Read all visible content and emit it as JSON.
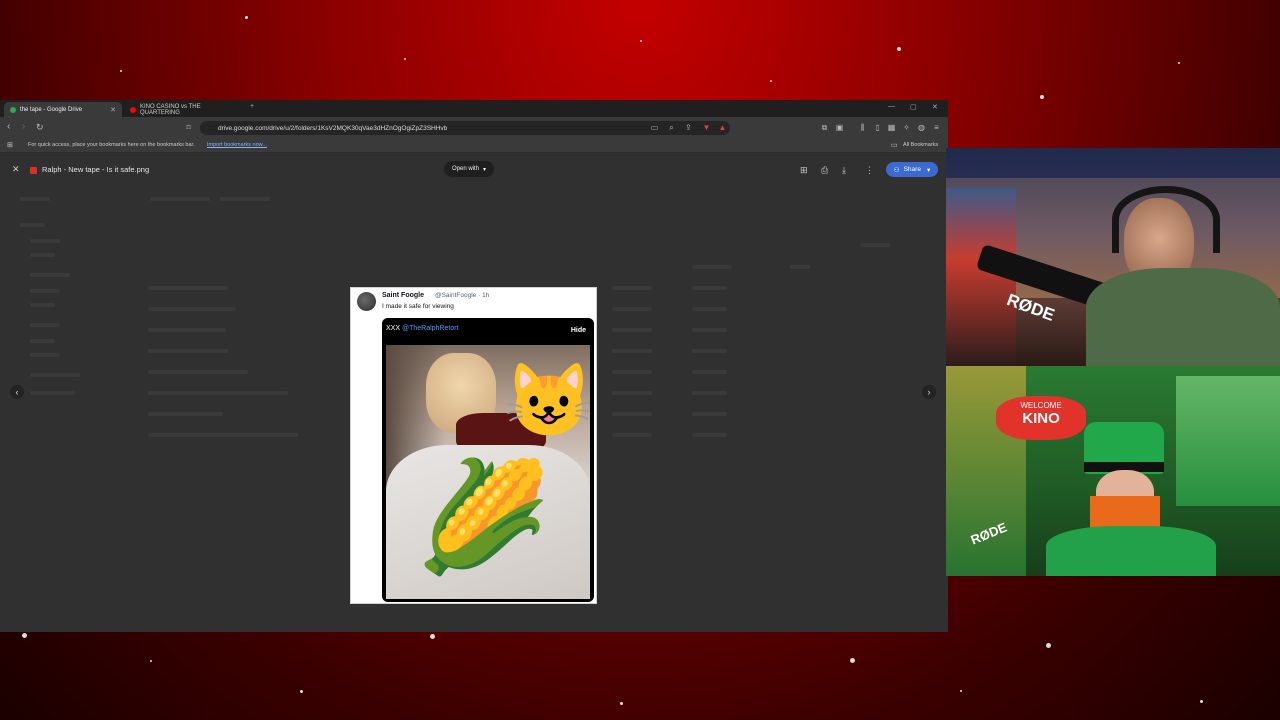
{
  "browser": {
    "tabs": [
      {
        "label": "the tape - Google Drive",
        "favicon_color": "#34a853"
      },
      {
        "label": "KINO CASINO vs THE QUARTERING",
        "favicon_color": "#ff0000"
      }
    ],
    "new_tab": "+",
    "url": "drive.google.com/drive/u/2/folders/1KsV2MQK30qVae3dHZnOgOgiZpZ3SHHvb",
    "bookmarks_bar_text": "For quick access, place your bookmarks here on the bookmarks bar.",
    "import_bookmarks": "Import bookmarks now...",
    "all_bookmarks": "All Bookmarks"
  },
  "viewer": {
    "file_title": "Ralph - New tape - Is it safe.png",
    "open_with": "Open with",
    "share": "Share"
  },
  "tweet": {
    "name": "Saint Foogle",
    "handle": "@SaintFoogle · 1h",
    "text": "I made it safe for viewing",
    "quote_prefix": "XXX",
    "quote_handle": "@TheRalphRetort",
    "hide_label": "Hide",
    "cat_emoji": "😺",
    "corn_emoji": "🌽"
  },
  "zoom_controls": {
    "minus": "−",
    "zoom": "⌕",
    "plus": "+"
  },
  "colors": {
    "share_blue": "#3b6ad0",
    "link_blue": "#4a9eff"
  },
  "overlay_labels": {
    "mic_brand": "RØDE",
    "sign_top": "WELCOME",
    "sign_word": "KINO"
  }
}
